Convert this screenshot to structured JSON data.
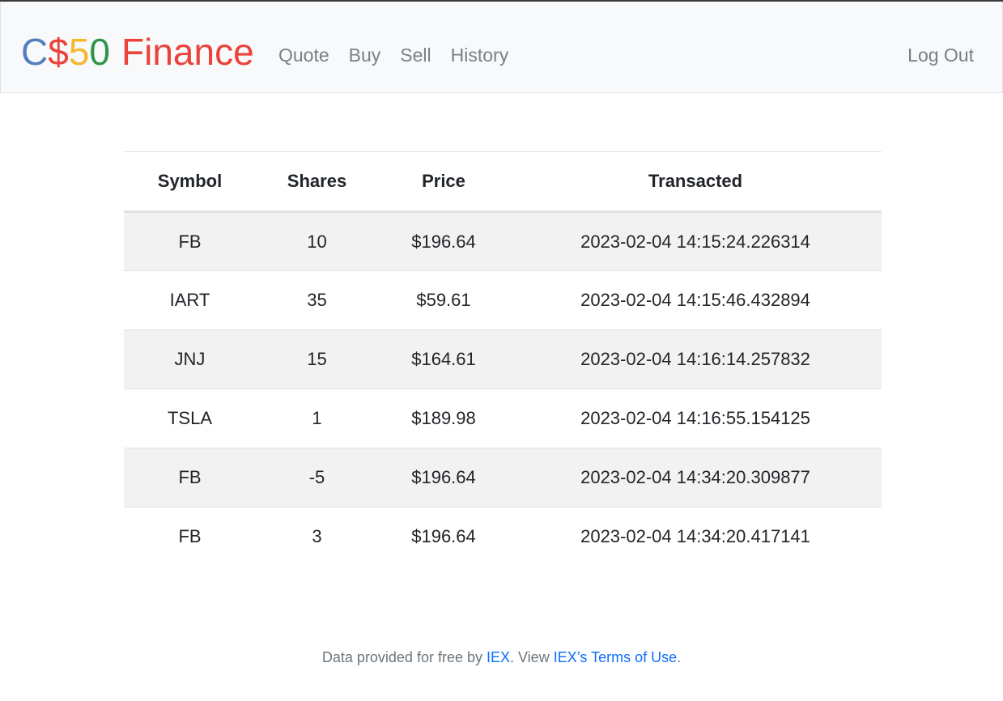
{
  "brand": {
    "parts": [
      {
        "text": "C",
        "color": "#537fbe"
      },
      {
        "text": "$",
        "color": "#ea433b"
      },
      {
        "text": "5",
        "color": "#f5b82e"
      },
      {
        "text": "0",
        "color": "#2e944b"
      },
      {
        "text": "Finance",
        "color": "#ea433b"
      }
    ]
  },
  "nav": {
    "links": [
      "Quote",
      "Buy",
      "Sell",
      "History"
    ],
    "logout": "Log Out"
  },
  "table": {
    "headers": [
      "Symbol",
      "Shares",
      "Price",
      "Transacted"
    ],
    "rows": [
      [
        "FB",
        "10",
        "$196.64",
        "2023-02-04 14:15:24.226314"
      ],
      [
        "IART",
        "35",
        "$59.61",
        "2023-02-04 14:15:46.432894"
      ],
      [
        "JNJ",
        "15",
        "$164.61",
        "2023-02-04 14:16:14.257832"
      ],
      [
        "TSLA",
        "1",
        "$189.98",
        "2023-02-04 14:16:55.154125"
      ],
      [
        "FB",
        "-5",
        "$196.64",
        "2023-02-04 14:34:20.309877"
      ],
      [
        "FB",
        "3",
        "$196.64",
        "2023-02-04 14:34:20.417141"
      ]
    ]
  },
  "footer": {
    "prefix": "Data provided for free by ",
    "iex_link": "IEX",
    "middle": ". View ",
    "terms_link": "IEX’s Terms of Use",
    "suffix": "."
  },
  "colors": {
    "link": "#0d6efd",
    "nav_text": "#7b7f84",
    "stripe": "#f2f2f2"
  }
}
